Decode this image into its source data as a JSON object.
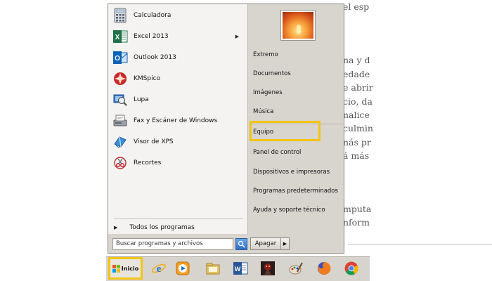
{
  "background_document": {
    "lines": [
      {
        "text": "el esp"
      },
      {
        "text": "na y d"
      },
      {
        "text": "edade"
      },
      {
        "text": "e abrir"
      },
      {
        "text": "cio, da"
      },
      {
        "text": "nalice"
      },
      {
        "text": "culmin"
      },
      {
        "text": "nás pr"
      },
      {
        "text": "á más"
      },
      {
        "text": "mputa"
      },
      {
        "text": "nform"
      }
    ]
  },
  "start_menu": {
    "programs": [
      {
        "label": "Calculadora",
        "icon": "calculator-icon"
      },
      {
        "label": "Excel 2013",
        "icon": "excel-icon",
        "has_submenu": true
      },
      {
        "label": "Outlook 2013",
        "icon": "outlook-icon"
      },
      {
        "label": "KMSpico",
        "icon": "kmspico-icon"
      },
      {
        "label": "Lupa",
        "icon": "magnifier-icon"
      },
      {
        "label": "Fax y Escáner de Windows",
        "icon": "fax-scanner-icon"
      },
      {
        "label": "Visor de XPS",
        "icon": "xps-viewer-icon"
      },
      {
        "label": "Recortes",
        "icon": "snipping-tool-icon"
      }
    ],
    "all_programs_label": "Todos los programas",
    "search_placeholder": "Buscar programas y archivos",
    "right_items": [
      {
        "label": "Extremo"
      },
      {
        "label": "Documentos"
      },
      {
        "label": "Imágenes"
      },
      {
        "label": "Música"
      },
      {
        "label": "Equipo",
        "highlighted": true
      },
      {
        "label": "Panel de control"
      },
      {
        "label": "Dispositivos e impresoras"
      },
      {
        "label": "Programas predeterminados"
      },
      {
        "label": "Ayuda y soporte técnico"
      }
    ],
    "shutdown_label": "Apagar",
    "highlight_color": "#f2c413"
  },
  "taskbar": {
    "start_label": "Inicio",
    "pinned": [
      {
        "name": "internet-explorer-icon"
      },
      {
        "name": "media-player-icon"
      },
      {
        "name": "file-explorer-icon"
      },
      {
        "name": "word-icon"
      },
      {
        "name": "game-icon"
      },
      {
        "name": "paint-icon"
      },
      {
        "name": "firefox-icon"
      },
      {
        "name": "chrome-icon"
      }
    ]
  },
  "colors": {
    "menu_bg": "#d8d4ce",
    "left_panel_bg": "#f4f3f1",
    "highlight": "#f2c413"
  }
}
